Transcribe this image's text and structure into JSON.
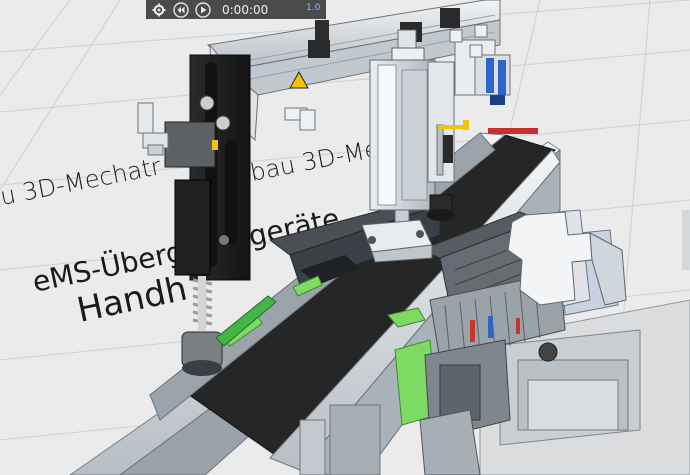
{
  "player": {
    "time": "0:00:00",
    "speed": "1.0",
    "icons": [
      "gear-icon",
      "rewind-icon",
      "play-icon"
    ]
  },
  "scene": {
    "floor_text": [
      {
        "id": "line1a",
        "text": "u 3D-Mechatr"
      },
      {
        "id": "line1b",
        "text": "bau 3D-Mech"
      },
      {
        "id": "line2a",
        "text": "eMS-Übergangsgeräte"
      },
      {
        "id": "line3",
        "text": "Handh"
      },
      {
        "id": "line3b",
        "text": "Handh"
      }
    ],
    "colors": {
      "background": "#ebebeb",
      "belt": "#2a2a2a",
      "aluminium": "#c8cdd2",
      "green": "#7ddb63",
      "blue": "#2e66c8",
      "warning": "#f5c400"
    }
  }
}
